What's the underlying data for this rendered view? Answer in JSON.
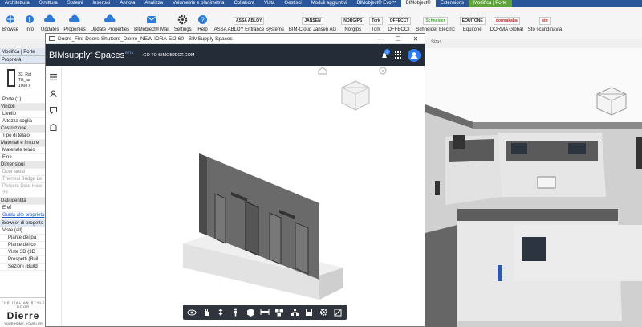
{
  "ribbon": {
    "tabs": [
      "Architettura",
      "Struttura",
      "Sistemi",
      "Inserisci",
      "Annota",
      "Analizza",
      "Volumetrie e planimetria",
      "Collabora",
      "Vista",
      "Gestisci",
      "Moduli aggiuntivi",
      "BIMobject® Evo™",
      "BIMobject®",
      "Extensions",
      "Modifica | Porte"
    ],
    "buttons": [
      "Browse",
      "Info",
      "Updates",
      "Properties",
      "Update Properties",
      "BIMobject® Mail",
      "Settings",
      "Help",
      "ASSA ABLOY Entrance Systems",
      "BIM-Cloud Jansen AG",
      "Norgips",
      "Tork",
      "OFFECCT",
      "Schneider Electric",
      "Equitone",
      "DORMA Global",
      "Sto scandinavia"
    ],
    "logos": [
      "ASSA ABLOY",
      "JANSEN",
      "NORGIPS",
      "Tork",
      "OFFECCT",
      "Schneider",
      "EQUITONE",
      "dormakaba",
      "sto"
    ],
    "group_label": "Sites"
  },
  "properties": {
    "context": "Modifica | Porte",
    "title": "Proprietà",
    "type_lines": [
      "33_Rat",
      "Tilt_tur",
      "1008 x"
    ],
    "selector": "Porte (1)",
    "rows": [
      {
        "t": "Vincoli",
        "k": "cat"
      },
      {
        "t": "Livello",
        "k": ""
      },
      {
        "t": "Altezza soglia",
        "k": ""
      },
      {
        "t": "Costruzione",
        "k": "cat"
      },
      {
        "t": "Tipo di telaio",
        "k": ""
      },
      {
        "t": "Materiali e finiture",
        "k": "cat"
      },
      {
        "t": "Materiale telaio",
        "k": ""
      },
      {
        "t": "Fine",
        "k": ""
      },
      {
        "t": "Dimensioni",
        "k": "cat"
      },
      {
        "t": "Door areal",
        "k": "dim"
      },
      {
        "t": "Thermal Bridge Le",
        "k": "dim"
      },
      {
        "t": "Percent Door Hole",
        "k": "dim"
      },
      {
        "t": "??",
        "k": "dim"
      },
      {
        "t": "Dati identità",
        "k": "cat"
      },
      {
        "t": "Eref",
        "k": ""
      },
      {
        "t": "Guida alle proprietà",
        "k": "link"
      }
    ],
    "browser_title": "Browser di progetto -",
    "browser_rows": [
      "Viste (all)",
      "Piante dei pa",
      "Piante dei co",
      "Viste 3D (3D",
      "Prospetti (Buil",
      "Sezioni (Build"
    ]
  },
  "brand_logo": {
    "tagline": "THE ITALIAN STYLE DOOR",
    "name": "Dierre",
    "slogan": "YOUR HOME, YOUR LIFE"
  },
  "bim_window": {
    "title": "Doors_Fire-Doors-Shutters_Dierre_NEW-IDRA-EI2-60 - BIMSupply Spaces",
    "brand": "BIMsupply",
    "brand2": "Spaces",
    "beta": "BETA",
    "goto": "GO TO BIMOBJECT.COM",
    "notif_count": "2",
    "min": "—",
    "max": "☐",
    "close": "✕"
  },
  "colors": {
    "header": "#242c38",
    "accent": "#2f7cf0",
    "toolbar": "#30353d"
  }
}
